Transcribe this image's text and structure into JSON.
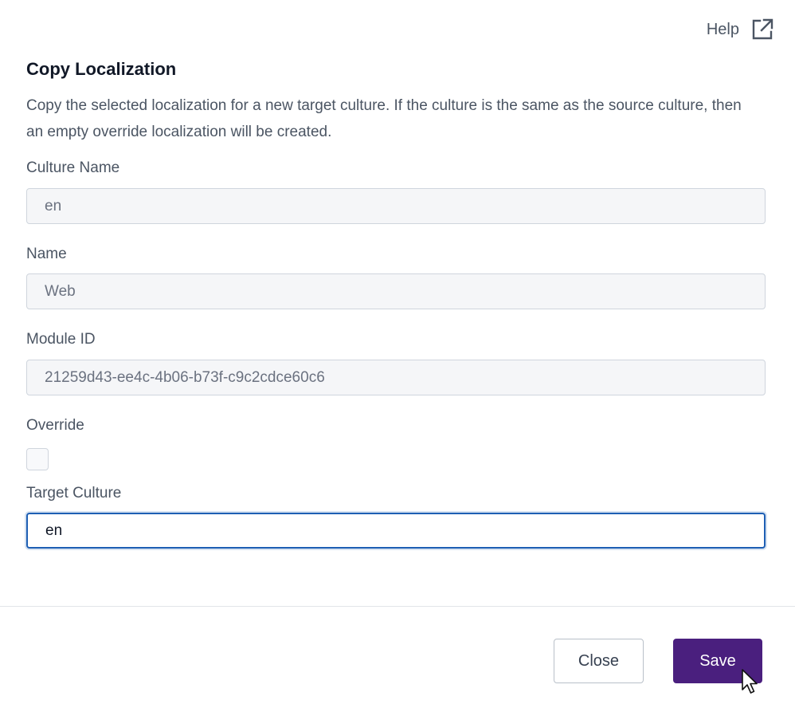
{
  "header": {
    "help_label": "Help",
    "help_icon": "external-link-icon"
  },
  "dialog": {
    "title": "Copy Localization",
    "description": "Copy the selected localization for a new target culture. If the culture is the same as the source culture, then an empty override localization will be created."
  },
  "fields": {
    "culture_name": {
      "label": "Culture Name",
      "value": "en"
    },
    "name": {
      "label": "Name",
      "value": "Web"
    },
    "module_id": {
      "label": "Module ID",
      "value": "21259d43-ee4c-4b06-b73f-c9c2cdce60c6"
    },
    "override": {
      "label": "Override",
      "checked": false
    },
    "target_culture": {
      "label": "Target Culture",
      "value": "en"
    }
  },
  "footer": {
    "close_label": "Close",
    "save_label": "Save"
  },
  "colors": {
    "primary": "#4a1f7e",
    "focus_border": "#1e5fb4",
    "text": "#4b5563",
    "title": "#111827"
  }
}
